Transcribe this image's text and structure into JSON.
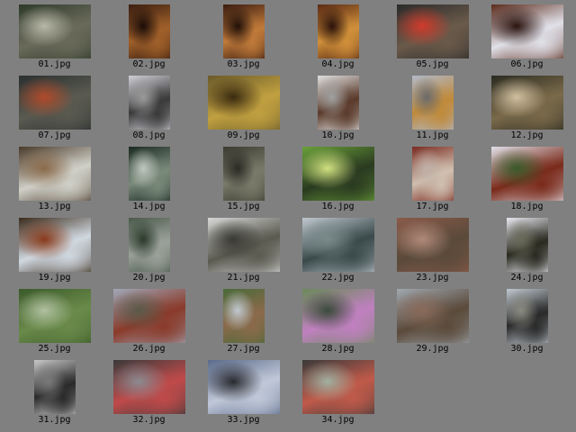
{
  "thumbnails": [
    {
      "label": "01.jpg",
      "colors": [
        "#2e3a2a",
        "#6a6a5a",
        "#b8b8a8"
      ]
    },
    {
      "label": "02.jpg",
      "colors": [
        "#3a1e10",
        "#a0602a",
        "#1a0c08"
      ]
    },
    {
      "label": "03.jpg",
      "colors": [
        "#3a1c10",
        "#c07a3a",
        "#201008"
      ]
    },
    {
      "label": "04.jpg",
      "colors": [
        "#5a2a14",
        "#d0903a",
        "#2a120a"
      ]
    },
    {
      "label": "05.jpg",
      "colors": [
        "#2a2a2a",
        "#6a5a4a",
        "#d03a2a"
      ]
    },
    {
      "label": "06.jpg",
      "colors": [
        "#5a2a1a",
        "#e0e0e8",
        "#2a1410"
      ]
    },
    {
      "label": "07.jpg",
      "colors": [
        "#2a3030",
        "#5a5a50",
        "#b04a2a"
      ]
    },
    {
      "label": "08.jpg",
      "colors": [
        "#d0d0d8",
        "#3a3a3a",
        "#9a9a9a"
      ]
    },
    {
      "label": "09.jpg",
      "colors": [
        "#6a5a2a",
        "#c0a040",
        "#3a2a10"
      ]
    },
    {
      "label": "10.jpg",
      "colors": [
        "#e0e0e0",
        "#5a3a2a",
        "#a0a0a0"
      ]
    },
    {
      "label": "11.jpg",
      "colors": [
        "#b0b8c8",
        "#c08a3a",
        "#6a6a6a"
      ]
    },
    {
      "label": "12.jpg",
      "colors": [
        "#2a2a20",
        "#7a6a4a",
        "#d0c0a0"
      ]
    },
    {
      "label": "13.jpg",
      "colors": [
        "#4a3a2a",
        "#d0d0c8",
        "#8a6a4a"
      ]
    },
    {
      "label": "14.jpg",
      "colors": [
        "#1a2a22",
        "#7a8a7a",
        "#c0c8c0"
      ]
    },
    {
      "label": "15.jpg",
      "colors": [
        "#3a3a30",
        "#7a7a6a",
        "#2a2a24"
      ]
    },
    {
      "label": "16.jpg",
      "colors": [
        "#6aa03a",
        "#2a3a20",
        "#d0e080"
      ]
    },
    {
      "label": "17.jpg",
      "colors": [
        "#7a2a20",
        "#d0c0b0",
        "#c0b0a8"
      ]
    },
    {
      "label": "18.jpg",
      "colors": [
        "#e0e0e8",
        "#7a2a1a",
        "#3a5a2a"
      ]
    },
    {
      "label": "19.jpg",
      "colors": [
        "#3a2a1a",
        "#d0d8e0",
        "#8a3a1a"
      ]
    },
    {
      "label": "20.jpg",
      "colors": [
        "#4a5a4a",
        "#9aa09a",
        "#2a3a2a"
      ]
    },
    {
      "label": "21.jpg",
      "colors": [
        "#d8d8d8",
        "#5a5a50",
        "#3a3a34"
      ]
    },
    {
      "label": "22.jpg",
      "colors": [
        "#c0c8d0",
        "#3a4a4a",
        "#7a8a8a"
      ]
    },
    {
      "label": "23.jpg",
      "colors": [
        "#8a5a4a",
        "#5a4a3a",
        "#b08a7a"
      ]
    },
    {
      "label": "24.jpg",
      "colors": [
        "#e8e8f0",
        "#2a2a20",
        "#6a6a5a"
      ]
    },
    {
      "label": "25.jpg",
      "colors": [
        "#3a5a2a",
        "#6a8a4a",
        "#b0c0a0"
      ]
    },
    {
      "label": "26.jpg",
      "colors": [
        "#a0a8b8",
        "#8a3a2a",
        "#5a5a4a"
      ]
    },
    {
      "label": "27.jpg",
      "colors": [
        "#4a6a3a",
        "#8a6a4a",
        "#c0c8d0"
      ]
    },
    {
      "label": "28.jpg",
      "colors": [
        "#6a8a5a",
        "#c080c0",
        "#3a4a3a"
      ]
    },
    {
      "label": "29.jpg",
      "colors": [
        "#a0a8b0",
        "#5a4a3a",
        "#8a6a5a"
      ]
    },
    {
      "label": "30.jpg",
      "colors": [
        "#c0c8d0",
        "#2a2a2a",
        "#8a8a80"
      ]
    },
    {
      "label": "31.jpg",
      "colors": [
        "#c8c8c8",
        "#2a2a2a",
        "#7a7a7a"
      ]
    },
    {
      "label": "32.jpg",
      "colors": [
        "#3a3a3a",
        "#c04a4a",
        "#8a8a90"
      ]
    },
    {
      "label": "33.jpg",
      "colors": [
        "#5a6a8a",
        "#c0c8d8",
        "#2a2a30"
      ]
    },
    {
      "label": "34.jpg",
      "colors": [
        "#3a3a3a",
        "#c05a4a",
        "#a0b0a0"
      ]
    }
  ]
}
